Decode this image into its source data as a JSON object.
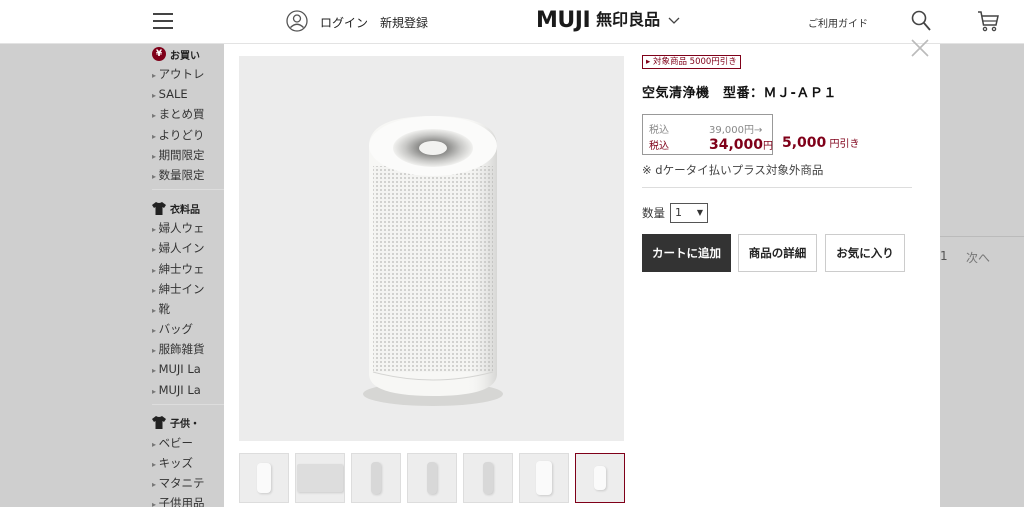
{
  "header": {
    "login": "ログイン",
    "register": "新規登録",
    "logo_en": "MUJI",
    "logo_jp": "無印良品",
    "guide": "ご利用ガイド"
  },
  "sidebar": {
    "sections": [
      {
        "title": "お買い",
        "icon": "yen-badge-icon",
        "items": [
          "アウトレ",
          "SALE",
          "まとめ買",
          "よりどり",
          "期間限定",
          "数量限定"
        ]
      },
      {
        "title": "衣料品",
        "icon": "shirt-icon",
        "items": [
          "婦人ウェ",
          "婦人イン",
          "紳士ウェ",
          "紳士イン",
          "靴",
          "バッグ",
          "服飾雑貨",
          "MUJI La",
          "MUJI La"
        ]
      },
      {
        "title": "子供・",
        "icon": "shirt-icon",
        "items": [
          "ベビー",
          "キッズ",
          "マタニテ",
          "子供用品"
        ]
      }
    ]
  },
  "background": {
    "page_number": "1",
    "next": "次へ"
  },
  "modal": {
    "tag": "対象商品 5000円引き",
    "title": "空気清浄機　型番：ＭＪ-ＡＰ１",
    "price": {
      "old_label": "税込",
      "old_value": "39,000",
      "old_unit": "円→",
      "new_label": "税込",
      "new_value": "34,000",
      "new_unit": "円"
    },
    "discount_value": "5,000",
    "discount_unit": "円引き",
    "note": "※ dケータイ払いプラス対象外商品",
    "qty_label": "数量",
    "qty_value": "1",
    "buttons": {
      "cart": "カートに追加",
      "detail": "商品の詳細",
      "favorite": "お気に入り"
    },
    "thumbnail_count": 7,
    "selected_thumbnail": 7
  },
  "colors": {
    "accent": "#7f0019",
    "dark_button": "#333333",
    "overlay_bg": "#cfcfcf"
  }
}
